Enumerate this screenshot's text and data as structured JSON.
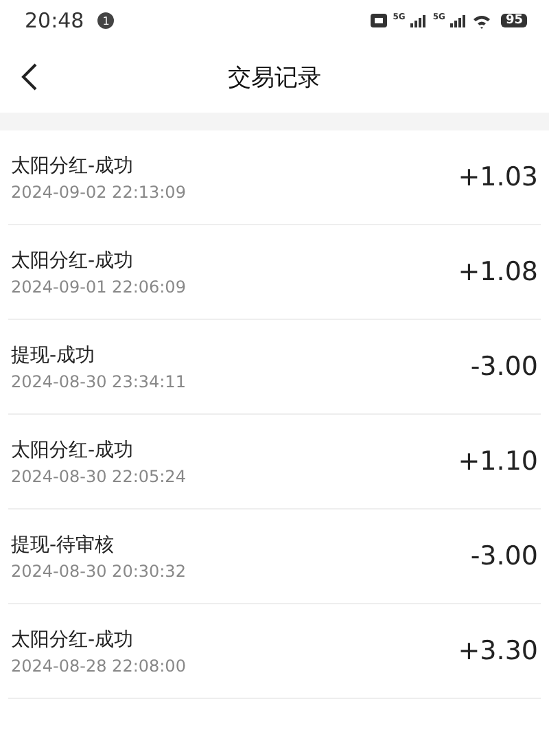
{
  "status_bar": {
    "time": "20:48",
    "notification_count": "1",
    "network_labels": [
      "5G",
      "5G"
    ],
    "battery": "95"
  },
  "header": {
    "title": "交易记录"
  },
  "records": [
    {
      "title": "太阳分红-成功",
      "time": "2024-09-02 22:13:09",
      "amount": "+1.03"
    },
    {
      "title": "太阳分红-成功",
      "time": "2024-09-01 22:06:09",
      "amount": "+1.08"
    },
    {
      "title": "提现-成功",
      "time": "2024-08-30 23:34:11",
      "amount": "-3.00"
    },
    {
      "title": "太阳分红-成功",
      "time": "2024-08-30 22:05:24",
      "amount": "+1.10"
    },
    {
      "title": "提现-待审核",
      "time": "2024-08-30 20:30:32",
      "amount": "-3.00"
    },
    {
      "title": "太阳分红-成功",
      "time": "2024-08-28 22:08:00",
      "amount": "+3.30"
    }
  ]
}
